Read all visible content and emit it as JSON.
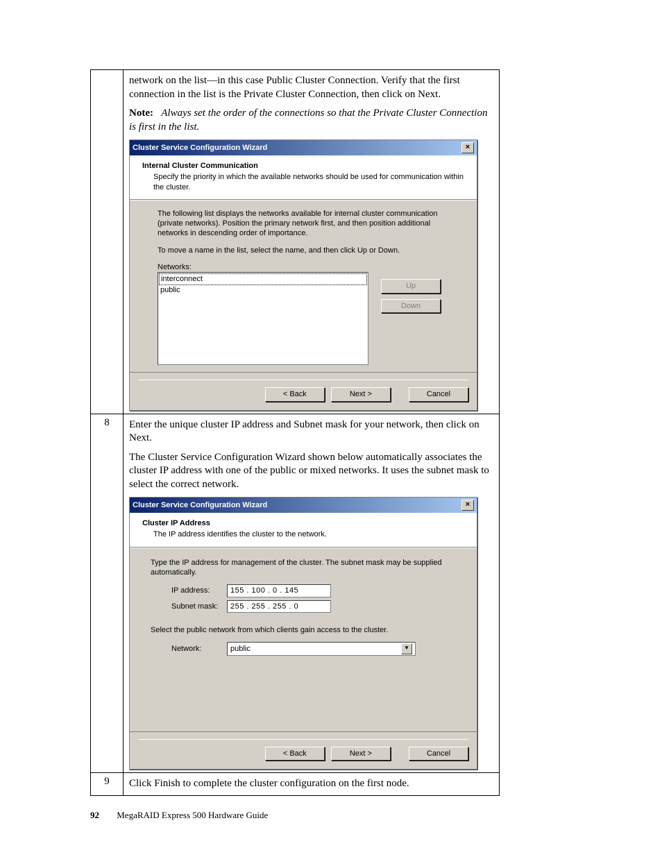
{
  "step7": {
    "intro1": "network on the list—in this case Public Cluster Connection. Verify that the first connection in the list is the Private Cluster Connection, then click on Next.",
    "note_label": "Note:",
    "note_text": "Always set the order of the connections so that the Private Cluster Connection is first in the list."
  },
  "wizard1": {
    "title": "Cluster Service Configuration Wizard",
    "header_title": "Internal Cluster Communication",
    "header_sub": "Specify the priority in which the available networks should be used for communication within the cluster.",
    "body_p1": "The following list displays the networks available for internal cluster communication (private networks). Position the primary network first, and then position additional networks in descending order of importance.",
    "body_p2": "To move a name in the list, select the name, and then click Up or Down.",
    "networks_label": "Networks:",
    "items": [
      "interconnect",
      "public"
    ],
    "up": "Up",
    "down": "Down",
    "back": "< Back",
    "next": "Next >",
    "cancel": "Cancel"
  },
  "step8": {
    "num": "8",
    "p1": "Enter the unique cluster IP address and Subnet mask for your network, then click on Next.",
    "p2": "The Cluster Service Configuration Wizard shown below automatically associates the cluster IP address with one of the public or mixed networks. It uses the subnet mask to select the correct network."
  },
  "wizard2": {
    "title": "Cluster Service Configuration Wizard",
    "header_title": "Cluster IP Address",
    "header_sub": "The IP address identifies the cluster to the network.",
    "body_p1": "Type the IP address for management of the cluster. The subnet mask may be supplied automatically.",
    "ip_label": "IP address:",
    "ip_value": "155 . 100 .   0   . 145",
    "mask_label": "Subnet mask:",
    "mask_value": "255 . 255 . 255 .   0",
    "body_p2": "Select the public network from which clients gain access to the cluster.",
    "network_label": "Network:",
    "network_value": "public",
    "back": "< Back",
    "next": "Next >",
    "cancel": "Cancel"
  },
  "step9": {
    "num": "9",
    "p1": "Click Finish to complete the cluster configuration on the first node."
  },
  "footer": {
    "page": "92",
    "title": "MegaRAID Express 500 Hardware Guide"
  }
}
